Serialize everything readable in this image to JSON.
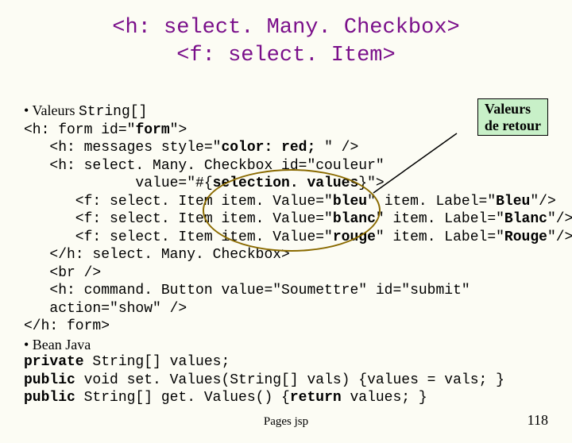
{
  "title_line1": "<h: select. Many. Checkbox>",
  "title_line2": "<f: select. Item>",
  "callout_line1": "Valeurs",
  "callout_line2": "de retour",
  "bullet1_prefix": "• Valeurs ",
  "bullet1_mono": "String[]",
  "code": {
    "l1a": "<h: form id=\"",
    "l1b": "form",
    "l1c": "\">",
    "l2a": "   <h: messages style=\"",
    "l2b": "color: red; ",
    "l2c": "\" />",
    "l3": "   <h: select. Many. Checkbox id=\"couleur\"",
    "l4a": "             value=\"#{",
    "l4b": "selection. values",
    "l4c": "}\">",
    "l5a": "      <f: select. Item item. Value=\"",
    "l5b": "bleu",
    "l5c": "\" item. Label=\"",
    "l5d": "Bleu",
    "l5e": "\"/>",
    "l6a": "      <f: select. Item item. Value=\"",
    "l6b": "blanc",
    "l6c": "\" item. Label=\"",
    "l6d": "Blanc",
    "l6e": "\"/>",
    "l7a": "      <f: select. Item item. Value=\"",
    "l7b": "rouge",
    "l7c": "\" item. Label=\"",
    "l7d": "Rouge",
    "l7e": "\"/>",
    "l8": "   </h: select. Many. Checkbox>",
    "l9": "   <br />",
    "l10": "   <h: command. Button value=\"Soumettre\" id=\"submit\"",
    "l11": "   action=\"show\" />",
    "l12": "</h: form>"
  },
  "bullet2": "• Bean Java",
  "java": {
    "j1a": "private",
    "j1b": " String[] values;",
    "j2a": "public",
    "j2b": " void set. Values(String[] vals) {values = vals; }",
    "j3a": "public",
    "j3b": " String[] get. Values() {",
    "j3c": "return",
    "j3d": " values; }"
  },
  "footer_center": "Pages jsp",
  "footer_right": "118"
}
